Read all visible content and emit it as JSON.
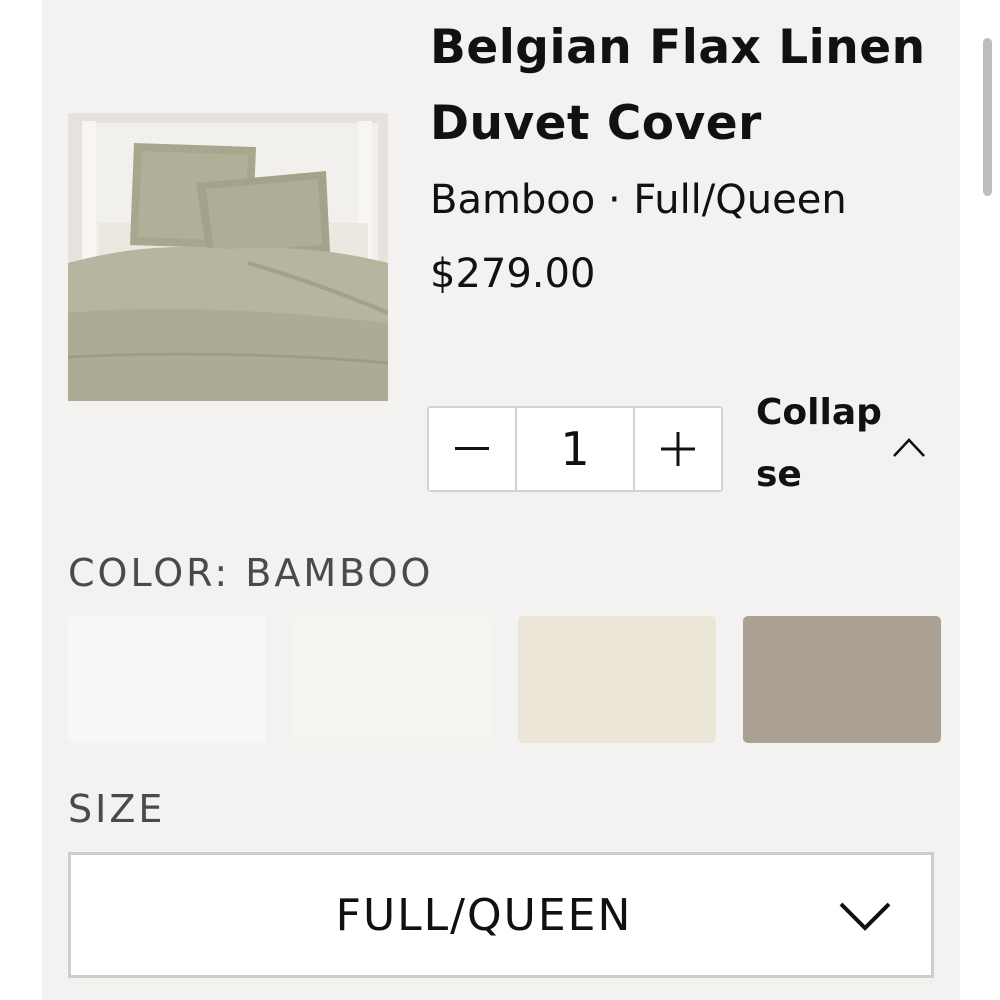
{
  "product": {
    "title": "Belgian Flax Linen Duvet Cover",
    "subtitle": "Bamboo · Full/Queen",
    "price": "$279.00"
  },
  "quantity": {
    "decrement_icon": "minus-icon",
    "value": "1",
    "increment_icon": "plus-icon"
  },
  "collapse": {
    "label": "Collapse",
    "icon": "chevron-up-icon"
  },
  "color": {
    "label": "COLOR: BAMBOO",
    "swatches": [
      {
        "color": "#f7f7f7"
      },
      {
        "color": "#f6f4ef"
      },
      {
        "color": "#ece6d8"
      },
      {
        "color": "#aaa193"
      }
    ]
  },
  "size": {
    "label": "SIZE",
    "selected": "FULL/QUEEN",
    "icon": "chevron-down-icon"
  },
  "colors": {
    "panel_background": "#f3f2f0",
    "border": "#d4d2cf",
    "label_gray": "#4a4a4a"
  }
}
